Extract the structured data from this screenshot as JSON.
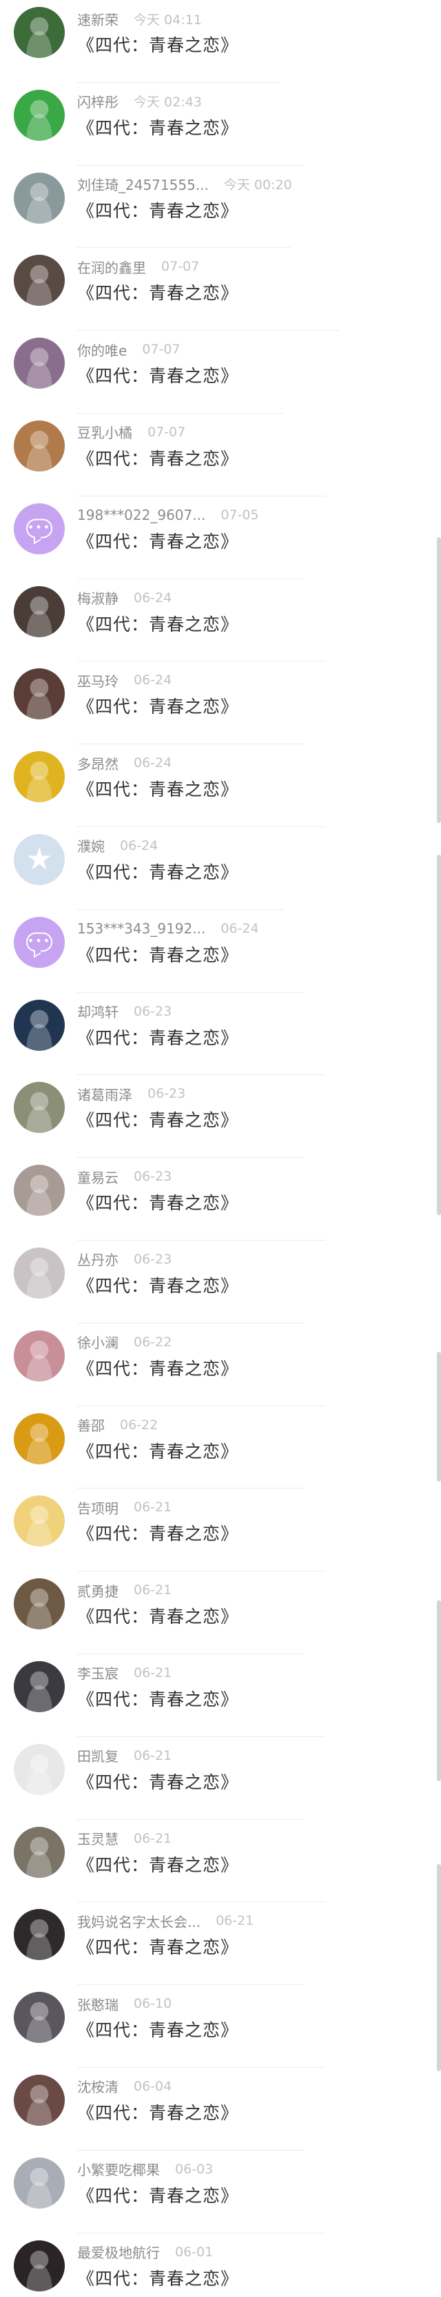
{
  "conversations": [
    {
      "name": "速新荣",
      "time": "今天 04:11",
      "message": "《四代：青春之恋》",
      "avatar": "photo-avatar",
      "avatar_color": "#3d6b3a"
    },
    {
      "name": "闪梓彤",
      "time": "今天 02:43",
      "message": "《四代：青春之恋》",
      "avatar": "cartoon-avatar",
      "avatar_color": "#3aa845"
    },
    {
      "name": "刘佳琦_24571555...",
      "time": "今天 00:20",
      "message": "《四代：青春之恋》",
      "avatar": "photo-avatar",
      "avatar_color": "#8a9a9c"
    },
    {
      "name": "在润的鑫里",
      "time": "07-07",
      "message": "《四代：青春之恋》",
      "avatar": "photo-avatar",
      "avatar_color": "#5a4a44"
    },
    {
      "name": "你的唯e",
      "time": "07-07",
      "message": "《四代：青春之恋》",
      "avatar": "photo-avatar",
      "avatar_color": "#8a6e8e"
    },
    {
      "name": "豆乳小橘",
      "time": "07-07",
      "message": "《四代：青春之恋》",
      "avatar": "photo-avatar",
      "avatar_color": "#b07a4a"
    },
    {
      "name": "198***022_9607...",
      "time": "07-05",
      "message": "《四代：青春之恋》",
      "avatar": "default-bubble-avatar",
      "avatar_color": "#c6a4f2"
    },
    {
      "name": "梅淑静",
      "time": "06-24",
      "message": "《四代：青春之恋》",
      "avatar": "photo-avatar",
      "avatar_color": "#4a3d38"
    },
    {
      "name": "巫马玲",
      "time": "06-24",
      "message": "《四代：青春之恋》",
      "avatar": "photo-avatar",
      "avatar_color": "#5a3d36"
    },
    {
      "name": "多昂然",
      "time": "06-24",
      "message": "《四代：青春之恋》",
      "avatar": "cartoon-avatar",
      "avatar_color": "#e0b320"
    },
    {
      "name": "濮婉",
      "time": "06-24",
      "message": "《四代：青春之恋》",
      "avatar": "default-star-avatar",
      "avatar_color": "#d3e0ee"
    },
    {
      "name": "153***343_9192...",
      "time": "06-24",
      "message": "《四代：青春之恋》",
      "avatar": "default-bubble-avatar",
      "avatar_color": "#c6a4f2"
    },
    {
      "name": "却鸿轩",
      "time": "06-23",
      "message": "《四代：青春之恋》",
      "avatar": "photo-avatar",
      "avatar_color": "#1f3550"
    },
    {
      "name": "诸葛雨泽",
      "time": "06-23",
      "message": "《四代：青春之恋》",
      "avatar": "photo-avatar",
      "avatar_color": "#8a8f76"
    },
    {
      "name": "童易云",
      "time": "06-23",
      "message": "《四代：青春之恋》",
      "avatar": "photo-avatar",
      "avatar_color": "#a89a94"
    },
    {
      "name": "丛丹亦",
      "time": "06-23",
      "message": "《四代：青春之恋》",
      "avatar": "photo-avatar",
      "avatar_color": "#c9c3c6"
    },
    {
      "name": "徐小澜",
      "time": "06-22",
      "message": "《四代：青春之恋》",
      "avatar": "photo-avatar",
      "avatar_color": "#c98f98"
    },
    {
      "name": "善邵",
      "time": "06-22",
      "message": "《四代：青春之恋》",
      "avatar": "photo-avatar",
      "avatar_color": "#d99a14"
    },
    {
      "name": "告项明",
      "time": "06-21",
      "message": "《四代：青春之恋》",
      "avatar": "photo-avatar",
      "avatar_color": "#f0d27a"
    },
    {
      "name": "贰勇捷",
      "time": "06-21",
      "message": "《四代：青春之恋》",
      "avatar": "photo-avatar",
      "avatar_color": "#6e5a44"
    },
    {
      "name": "李玉宸",
      "time": "06-21",
      "message": "《四代：青春之恋》",
      "avatar": "photo-avatar",
      "avatar_color": "#3a3a40"
    },
    {
      "name": "田凯复",
      "time": "06-21",
      "message": "《四代：青春之恋》",
      "avatar": "meme-avatar",
      "avatar_color": "#e8e8e8"
    },
    {
      "name": "玉灵慧",
      "time": "06-21",
      "message": "《四代：青春之恋》",
      "avatar": "photo-avatar",
      "avatar_color": "#7a7366"
    },
    {
      "name": "我妈说名字太长会...",
      "time": "06-21",
      "message": "《四代：青春之恋》",
      "avatar": "photo-avatar",
      "avatar_color": "#2e2a2c"
    },
    {
      "name": "张憨瑞",
      "time": "06-10",
      "message": "《四代：青春之恋》",
      "avatar": "photo-avatar",
      "avatar_color": "#5a5660"
    },
    {
      "name": "沈桉清",
      "time": "06-04",
      "message": "《四代：青春之恋》",
      "avatar": "photo-avatar",
      "avatar_color": "#6b4a46"
    },
    {
      "name": "小繁要吃椰果",
      "time": "06-03",
      "message": "《四代：青春之恋》",
      "avatar": "photo-avatar",
      "avatar_color": "#a8adb6"
    },
    {
      "name": "最爱极地航行",
      "time": "06-01",
      "message": "《四代：青春之恋》",
      "avatar": "photo-avatar",
      "avatar_color": "#2a2426"
    }
  ]
}
